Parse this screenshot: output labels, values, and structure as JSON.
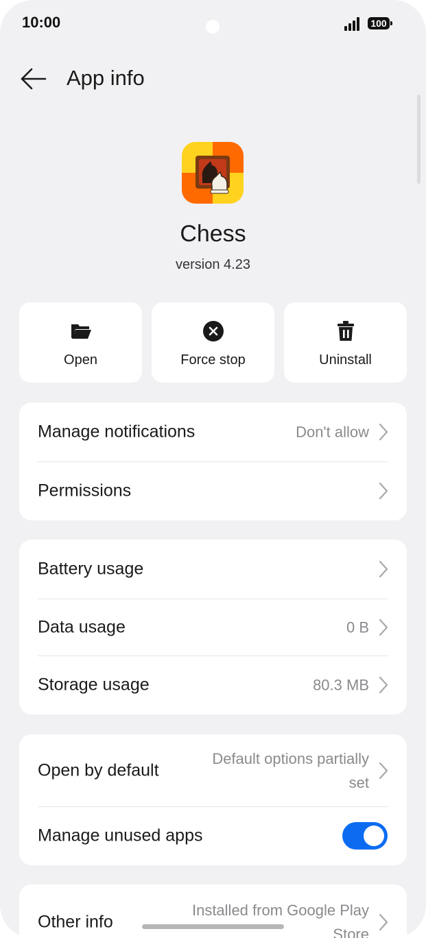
{
  "status_bar": {
    "time": "10:00",
    "battery": "100"
  },
  "header": {
    "title": "App info",
    "back_icon": "arrow-left-icon"
  },
  "app": {
    "name": "Chess",
    "version": "version 4.23",
    "icon": "chess-app-icon"
  },
  "actions": [
    {
      "label": "Open",
      "icon": "folder-open-icon"
    },
    {
      "label": "Force stop",
      "icon": "close-circle-icon"
    },
    {
      "label": "Uninstall",
      "icon": "trash-icon"
    }
  ],
  "notifications_card": {
    "manage_notifications": {
      "label": "Manage notifications",
      "value": "Don't allow"
    },
    "permissions": {
      "label": "Permissions"
    }
  },
  "usage_card": {
    "battery": {
      "label": "Battery usage"
    },
    "data": {
      "label": "Data usage",
      "value": "0 B"
    },
    "storage": {
      "label": "Storage usage",
      "value": "80.3 MB"
    }
  },
  "defaults_card": {
    "open_by_default": {
      "label": "Open by default",
      "value_line1": "Default options partially",
      "value_line2": "set"
    },
    "manage_unused": {
      "label": "Manage unused apps",
      "enabled": true
    }
  },
  "other_card": {
    "other_info": {
      "label": "Other info",
      "value_line1": "Installed from Google Play",
      "value_line2": "Store"
    }
  },
  "colors": {
    "accent": "#0b6cf2",
    "background": "#f1f1f3",
    "card": "#ffffff"
  }
}
